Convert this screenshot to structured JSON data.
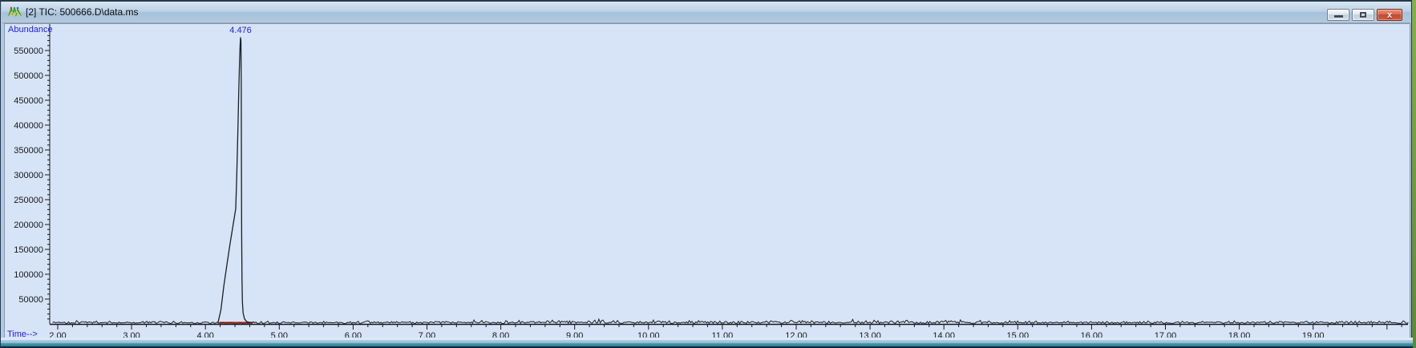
{
  "window": {
    "title": "[2] TIC: 500666.D\\data.ms",
    "icon": "chromatogram-app-icon",
    "controls": {
      "minimize": "Minimize",
      "restore": "Restore",
      "close": "Close"
    }
  },
  "colors": {
    "plot_background": "#d7e4f7",
    "axis": "#15171b",
    "trace": "#1b1e24",
    "blue_label": "#2222dd",
    "integration_red": "#e8392b",
    "titlebar_text": "#0d0d0d"
  },
  "chart_data": {
    "type": "line",
    "title": "",
    "xlabel": "Time-->",
    "ylabel": "Abundance",
    "xlim": [
      1.9,
      20.35
    ],
    "ylim": [
      0,
      603000
    ],
    "grid": false,
    "x_major_tick_step": 1.0,
    "x_minor_tick_step": 0.2,
    "x_tick_values": [
      2,
      3,
      4,
      5,
      6,
      7,
      8,
      9,
      10,
      11,
      12,
      13,
      14,
      15,
      16,
      17,
      18,
      19
    ],
    "x_tick_labels": [
      "2.00",
      "3.00",
      "4.00",
      "5.00",
      "6.00",
      "7.00",
      "8.00",
      "9.00",
      "10.00",
      "11.00",
      "12.00",
      "13.00",
      "14.00",
      "15.00",
      "16.00",
      "17.00",
      "18.00",
      "19.00"
    ],
    "x_unlabeled_major_ticks": [
      20
    ],
    "y_minor_tick_step": 10000,
    "y_tick_values": [
      50000,
      100000,
      150000,
      200000,
      250000,
      300000,
      350000,
      400000,
      450000,
      500000,
      550000
    ],
    "y_tick_labels": [
      "50000",
      "100000",
      "150000",
      "200000",
      "250000",
      "300000",
      "350000",
      "400000",
      "450000",
      "500000",
      "550000"
    ],
    "peak": {
      "label": "4.476",
      "retention_time": 4.476,
      "apex_abundance": 576000,
      "start_time": 4.17,
      "end_time": 4.64,
      "integration_start": 4.19,
      "integration_end": 4.64,
      "points": [
        [
          4.17,
          2500
        ],
        [
          4.21,
          28000
        ],
        [
          4.25,
          77000
        ],
        [
          4.29,
          118000
        ],
        [
          4.33,
          158000
        ],
        [
          4.37,
          195000
        ],
        [
          4.41,
          232000
        ],
        [
          4.425,
          300000
        ],
        [
          4.44,
          390000
        ],
        [
          4.452,
          470000
        ],
        [
          4.462,
          530000
        ],
        [
          4.47,
          562000
        ],
        [
          4.476,
          576000
        ],
        [
          4.481,
          570000
        ],
        [
          4.485,
          480000
        ],
        [
          4.488,
          330000
        ],
        [
          4.491,
          180000
        ],
        [
          4.495,
          90000
        ],
        [
          4.5,
          45000
        ],
        [
          4.51,
          22000
        ],
        [
          4.53,
          10000
        ],
        [
          4.56,
          4500
        ],
        [
          4.6,
          2800
        ],
        [
          4.64,
          2200
        ]
      ]
    },
    "baseline": {
      "level": 1500,
      "noise_amplitude": 4000,
      "dense_noise_region": [
        7.5,
        15.2
      ],
      "trace_start": 1.93,
      "trace_end": 20.3
    }
  }
}
